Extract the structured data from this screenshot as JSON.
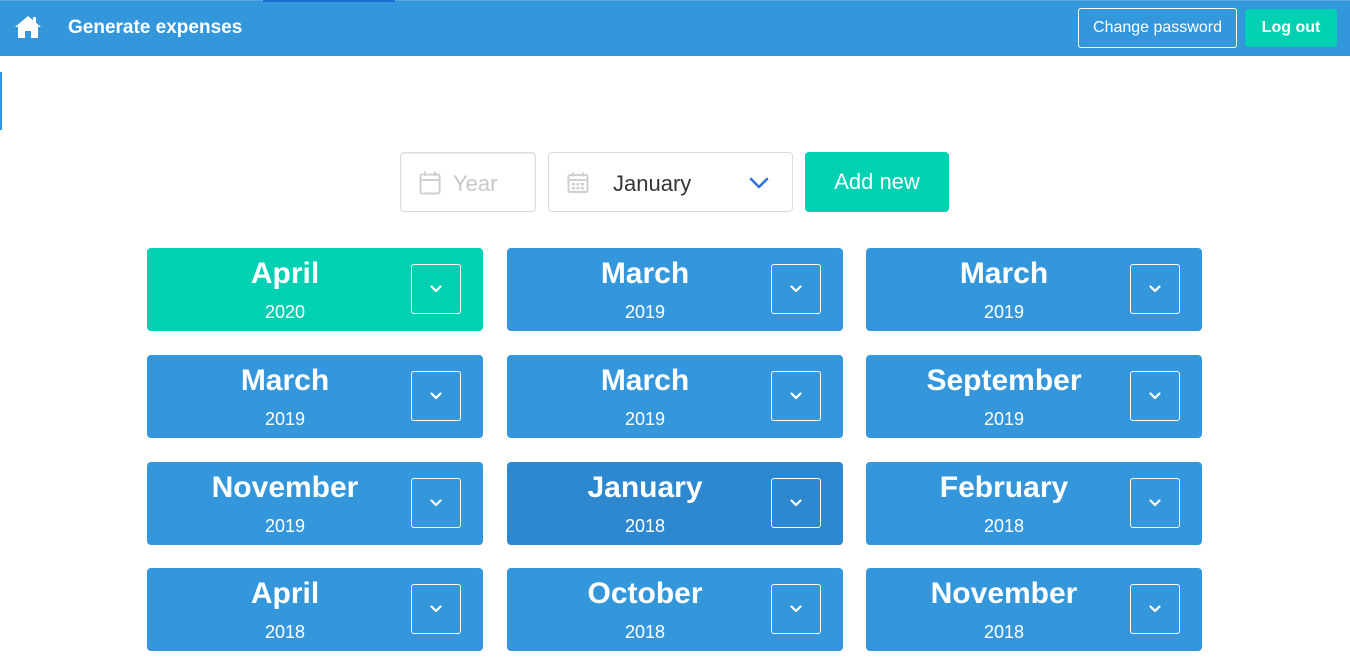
{
  "header": {
    "brand": "Generate expenses",
    "change_password_label": "Change password",
    "logout_label": "Log out",
    "home_icon": "home-icon"
  },
  "form": {
    "year_placeholder": "Year",
    "year_value": "",
    "month_selected": "January",
    "add_label": "Add new"
  },
  "colors": {
    "primary": "#3497dc",
    "accent": "#00d1b2",
    "hover": "#2d88cf"
  },
  "cards": [
    {
      "month": "April",
      "year": "2020",
      "style": "accent"
    },
    {
      "month": "March",
      "year": "2019",
      "style": "primary"
    },
    {
      "month": "March",
      "year": "2019",
      "style": "primary"
    },
    {
      "month": "March",
      "year": "2019",
      "style": "primary"
    },
    {
      "month": "March",
      "year": "2019",
      "style": "primary"
    },
    {
      "month": "September",
      "year": "2019",
      "style": "primary"
    },
    {
      "month": "November",
      "year": "2019",
      "style": "primary"
    },
    {
      "month": "January",
      "year": "2018",
      "style": "hover"
    },
    {
      "month": "February",
      "year": "2018",
      "style": "primary"
    },
    {
      "month": "April",
      "year": "2018",
      "style": "primary"
    },
    {
      "month": "October",
      "year": "2018",
      "style": "primary"
    },
    {
      "month": "November",
      "year": "2018",
      "style": "primary"
    }
  ]
}
